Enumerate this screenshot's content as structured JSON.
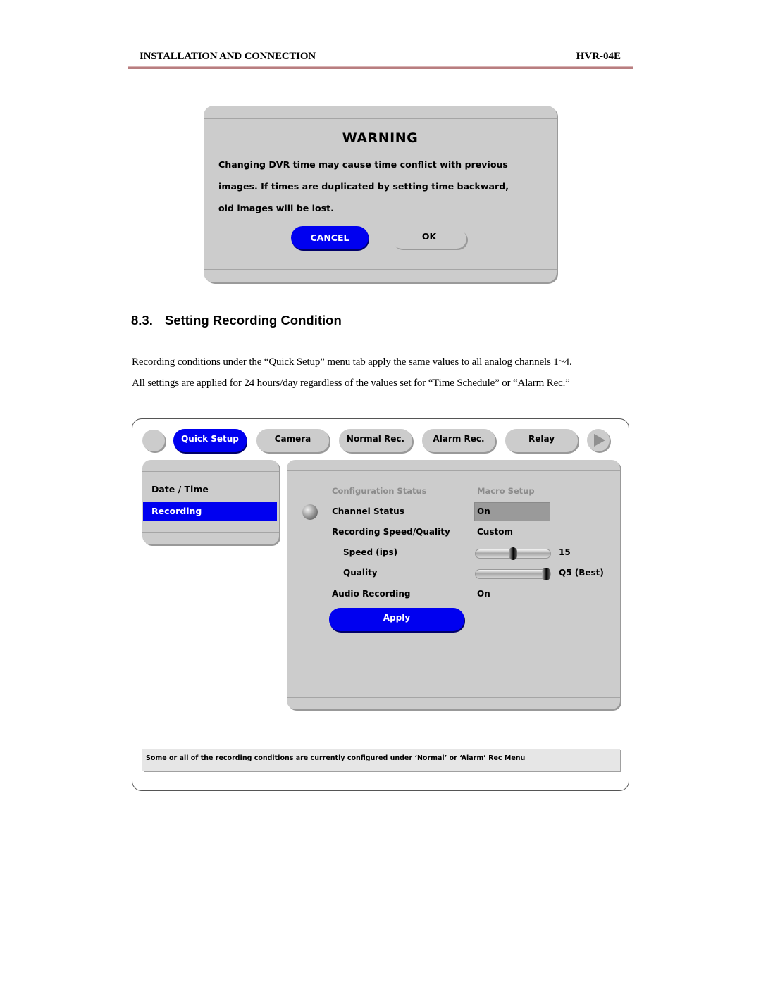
{
  "page_header": {
    "section": "INSTALLATION AND CONNECTION",
    "model": "HVR-04E",
    "rule_color": "#b87e80"
  },
  "warning_dialog": {
    "title": "WARNING",
    "message_lines": [
      "Changing DVR time may cause time conflict with previous",
      "images. If times are duplicated by setting time backward,",
      "old images will be lost."
    ],
    "cancel_label": "CANCEL",
    "ok_label": "OK",
    "accent_color": "#0000f0"
  },
  "section": {
    "number": "8.3.",
    "title": "Setting Recording Condition",
    "paragraphs": [
      "Recording conditions under the “Quick Setup” menu tab apply the same values to all analog channels 1~4.",
      "All settings are applied for 24 hours/day regardless of the values set for “Time Schedule” or “Alarm Rec.”"
    ]
  },
  "recording_ui": {
    "tabs": [
      {
        "label": "Quick Setup",
        "active": true
      },
      {
        "label": "Camera",
        "active": false
      },
      {
        "label": "Normal Rec.",
        "active": false
      },
      {
        "label": "Alarm Rec.",
        "active": false
      },
      {
        "label": "Relay",
        "active": false
      }
    ],
    "icons": {
      "left_round_button": "circle-button-icon",
      "next_button": "play-arrow-icon",
      "row_bullet": "sphere-bullet-icon"
    },
    "sidebar": {
      "items": [
        {
          "label": "Date / Time",
          "selected": false
        },
        {
          "label": "Recording",
          "selected": true
        }
      ]
    },
    "columns": {
      "left": "Configuration Status",
      "right": "Macro Setup"
    },
    "settings": {
      "channel_status": {
        "label": "Channel Status",
        "value": "On"
      },
      "speed_quality": {
        "label": "Recording Speed/Quality",
        "value": "Custom"
      },
      "speed": {
        "label": "Speed (ips)",
        "value": "15",
        "slider_fraction": 0.5
      },
      "quality": {
        "label": "Quality",
        "value": "Q5 (Best)",
        "slider_fraction": 1.0
      },
      "audio": {
        "label": "Audio Recording",
        "value": "On"
      }
    },
    "apply_label": "Apply",
    "status_message": "Some or all of the recording conditions are currently configured under ‘Normal’ or ‘Alarm’ Rec Menu"
  }
}
